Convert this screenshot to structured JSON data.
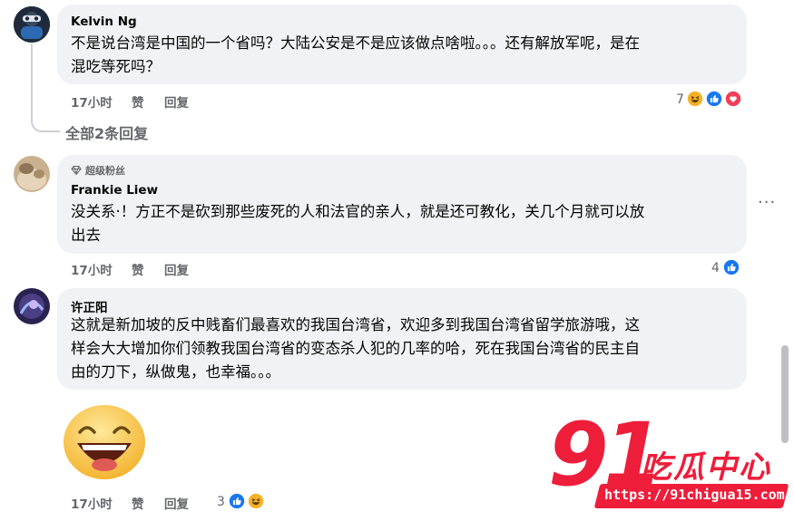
{
  "comments": [
    {
      "author": "Kelvin Ng",
      "lines": [
        "不是说台湾是中国的一个省吗？大陆公安是不是应该做点啥啦。。。还有解放军呢，是在",
        "混吃等死吗？"
      ],
      "time": "17小时",
      "like_label": "赞",
      "reply_label": "回复",
      "reaction_count": "7",
      "reactions": [
        "haha-icon",
        "like-icon",
        "love-icon"
      ]
    },
    {
      "badge": "超级粉丝",
      "author": "Frankie Liew",
      "lines": [
        "没关系·！方正不是砍到那些废死的人和法官的亲人，就是还可教化，关几个月就可以放",
        "出去"
      ],
      "time": "17小时",
      "like_label": "赞",
      "reply_label": "回复",
      "reaction_count": "4",
      "reactions": [
        "like-icon"
      ],
      "more_label": "···"
    },
    {
      "author": "许正阳",
      "lines": [
        "这就是新加坡的反中贱畜们最喜欢的我国台湾省，欢迎多到我国台湾省留学旅游哦，这",
        "样会大大增加你们领教我国台湾省的变态杀人犯的几率的哈，死在我国台湾省的民主自",
        "由的刀下，纵做鬼，也幸福。。。"
      ],
      "time": "17小时",
      "like_label": "赞",
      "reply_label": "回复",
      "reaction_count": "3",
      "reactions": [
        "like-icon",
        "haha-icon"
      ],
      "sticker": "laughing-face-sticker"
    }
  ],
  "view_replies_label": "全部2条回复",
  "watermark": {
    "number": "91",
    "text": "吃瓜中心",
    "url": "https://91chigua15.com"
  },
  "colors": {
    "bubble": "#f0f2f5",
    "meta": "#65676b",
    "like_blue": "#1877f2",
    "love_red": "#f33e58",
    "haha_yellow": "#f7b125",
    "watermark_red": "#ee1d3a"
  }
}
